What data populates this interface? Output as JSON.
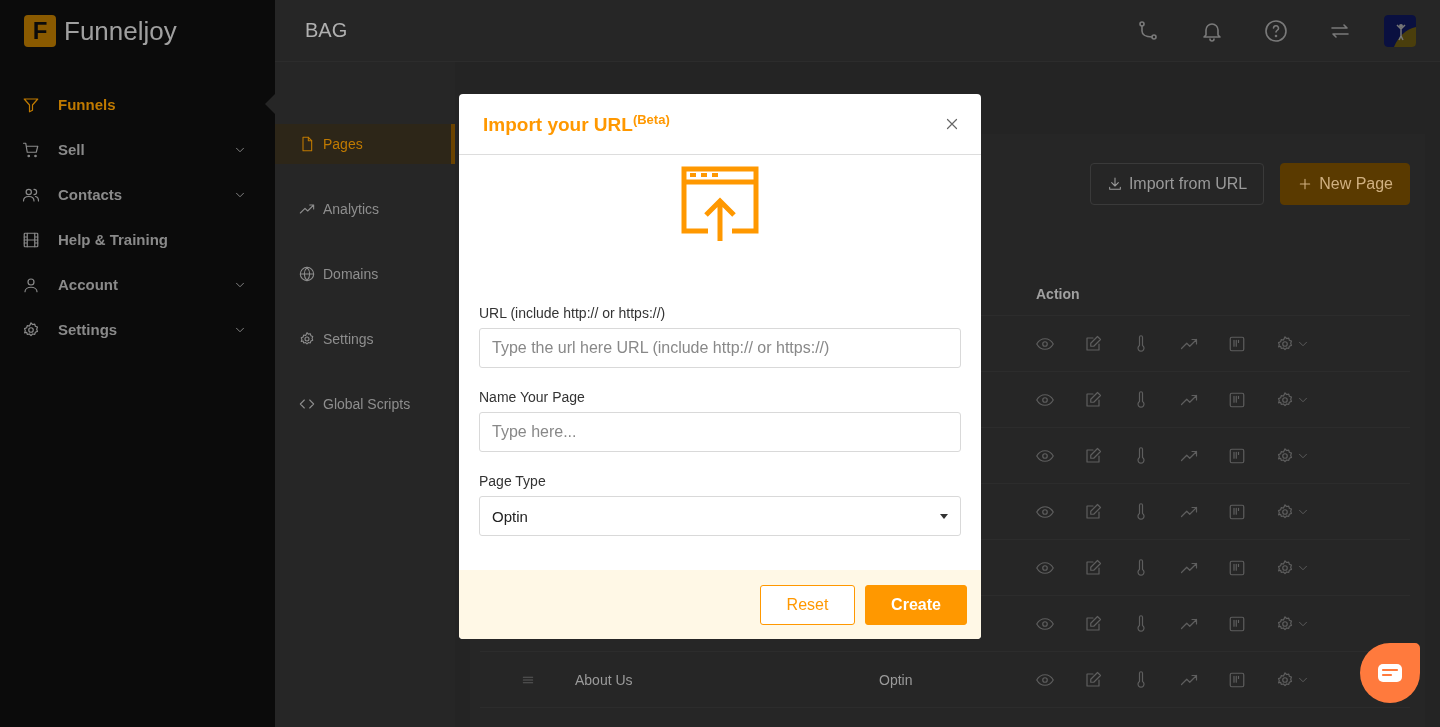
{
  "brand": {
    "logo_letter": "F",
    "name": "Funneljoy"
  },
  "sidebar": {
    "items": [
      {
        "label": "Funnels",
        "selected": true,
        "expandable": false
      },
      {
        "label": "Sell",
        "selected": false,
        "expandable": true
      },
      {
        "label": "Contacts",
        "selected": false,
        "expandable": true
      },
      {
        "label": "Help & Training",
        "selected": false,
        "expandable": false
      },
      {
        "label": "Account",
        "selected": false,
        "expandable": true
      },
      {
        "label": "Settings",
        "selected": false,
        "expandable": true
      }
    ]
  },
  "header": {
    "title": "BAG"
  },
  "subnav": {
    "items": [
      {
        "label": "Pages",
        "selected": true
      },
      {
        "label": "Analytics",
        "selected": false
      },
      {
        "label": "Domains",
        "selected": false
      },
      {
        "label": "Settings",
        "selected": false
      },
      {
        "label": "Global Scripts",
        "selected": false
      }
    ]
  },
  "toolbar": {
    "buttons": [
      {
        "label": "Import from URL",
        "kind": "outline"
      },
      {
        "label": "New Page",
        "kind": "primary"
      }
    ]
  },
  "table": {
    "columns": [
      "Action"
    ],
    "rows": [
      {
        "kind": "covered"
      },
      {
        "kind": "covered"
      },
      {
        "kind": "covered"
      },
      {
        "kind": "covered"
      },
      {
        "kind": "covered"
      },
      {
        "kind": "covered"
      },
      {
        "kind": "page",
        "name": "About Us",
        "type": "Optin"
      }
    ]
  },
  "modal": {
    "title": "Import your URL$^{(Beta)}$",
    "fields": [
      {
        "kind": "text",
        "label": "URL (include http:// or https://)",
        "placeholder": "Type the url here URL (include http:// or https://)"
      },
      {
        "kind": "text",
        "label": "Name Your Page",
        "placeholder": "Type here..."
      },
      {
        "kind": "select",
        "label": "Page Type",
        "value": "Optin"
      }
    ],
    "buttons": [
      {
        "label": "Reset",
        "kind": "outline"
      },
      {
        "label": "Create",
        "kind": "primary"
      }
    ]
  }
}
